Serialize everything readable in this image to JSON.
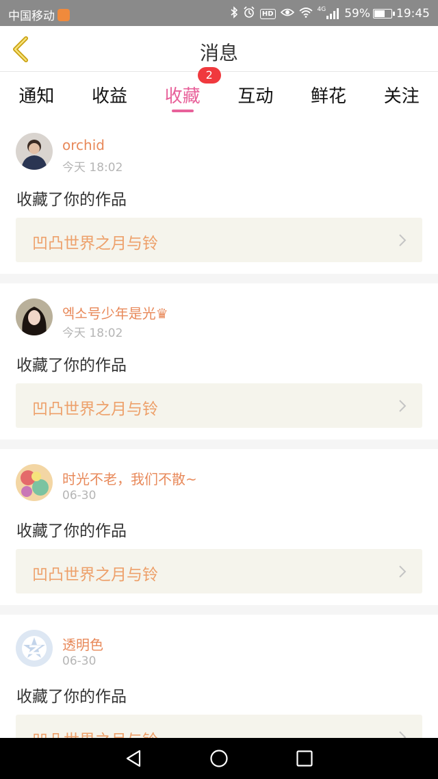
{
  "status_bar": {
    "carrier": "中国移动",
    "battery": "59%",
    "battery_level": 0.59,
    "time": "19:45",
    "network": "4G",
    "hd": "HD",
    "icons": [
      "bluetooth-icon",
      "alarm-icon",
      "hd-icon",
      "eye-icon",
      "wifi-icon",
      "signal-icon",
      "battery-icon"
    ]
  },
  "header": {
    "title": "消息",
    "back_icon": "chevron-left-icon"
  },
  "tabs": [
    {
      "label": "通知"
    },
    {
      "label": "收益"
    },
    {
      "label": "收藏",
      "badge": "2",
      "active": true
    },
    {
      "label": "互动"
    },
    {
      "label": "鲜花"
    },
    {
      "label": "关注"
    }
  ],
  "feed": [
    {
      "user": "orchid",
      "time": "今天 18:02",
      "message": "收藏了你的作品",
      "work": "凹凸世界之月与铃"
    },
    {
      "user": "엑소号少年是光♛",
      "time": "今天 18:02",
      "message": "收藏了你的作品",
      "work": "凹凸世界之月与铃"
    },
    {
      "user": "时光不老，我们不散~",
      "time": "06-30",
      "message": "收藏了你的作品",
      "work": "凹凸世界之月与铃"
    },
    {
      "user": "透明色",
      "time": "06-30",
      "message": "收藏了你的作品",
      "work": "凹凸世界之月与铃"
    }
  ],
  "colors": {
    "accent": "#e8619a",
    "badge": "#f0393e",
    "username": "#e8895a",
    "work_title": "#eda06a",
    "work_bg": "#f5f4ec"
  },
  "nav_bar": {
    "icons": [
      "back-triangle-icon",
      "home-circle-icon",
      "recents-square-icon"
    ]
  }
}
